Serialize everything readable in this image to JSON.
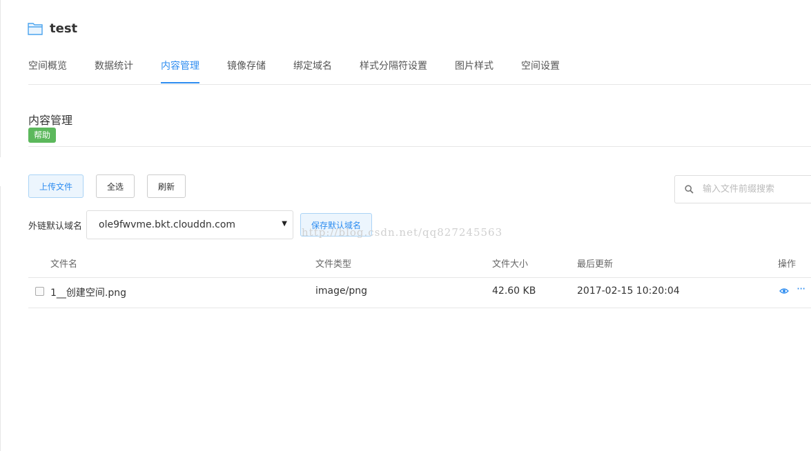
{
  "space": {
    "name": "test"
  },
  "tabs": [
    {
      "label": "空间概览"
    },
    {
      "label": "数据统计"
    },
    {
      "label": "内容管理"
    },
    {
      "label": "镜像存储"
    },
    {
      "label": "绑定域名"
    },
    {
      "label": "样式分隔符设置"
    },
    {
      "label": "图片样式"
    },
    {
      "label": "空间设置"
    }
  ],
  "active_tab": "内容管理",
  "section": {
    "title": "内容管理",
    "help_label": "帮助"
  },
  "toolbar": {
    "upload_label": "上传文件",
    "select_all_label": "全选",
    "refresh_label": "刷新"
  },
  "search": {
    "placeholder": "输入文件前缀搜索",
    "value": ""
  },
  "domain": {
    "label": "外链默认域名",
    "selected": "ole9fwvme.bkt.clouddn.com",
    "save_label": "保存默认域名"
  },
  "watermark": "http://blog.csdn.net/qq827245563",
  "table": {
    "headers": {
      "name": "文件名",
      "type": "文件类型",
      "size": "文件大小",
      "updated": "最后更新",
      "actions": "操作"
    },
    "rows": [
      {
        "name": "1__创建空间.png",
        "type": "image/png",
        "size": "42.60 KB",
        "updated": "2017-02-15 10:20:04",
        "more": "···"
      }
    ]
  },
  "colors": {
    "accent": "#2d8cf0",
    "help_badge": "#5cb85c",
    "border": "#e6e6e6"
  }
}
